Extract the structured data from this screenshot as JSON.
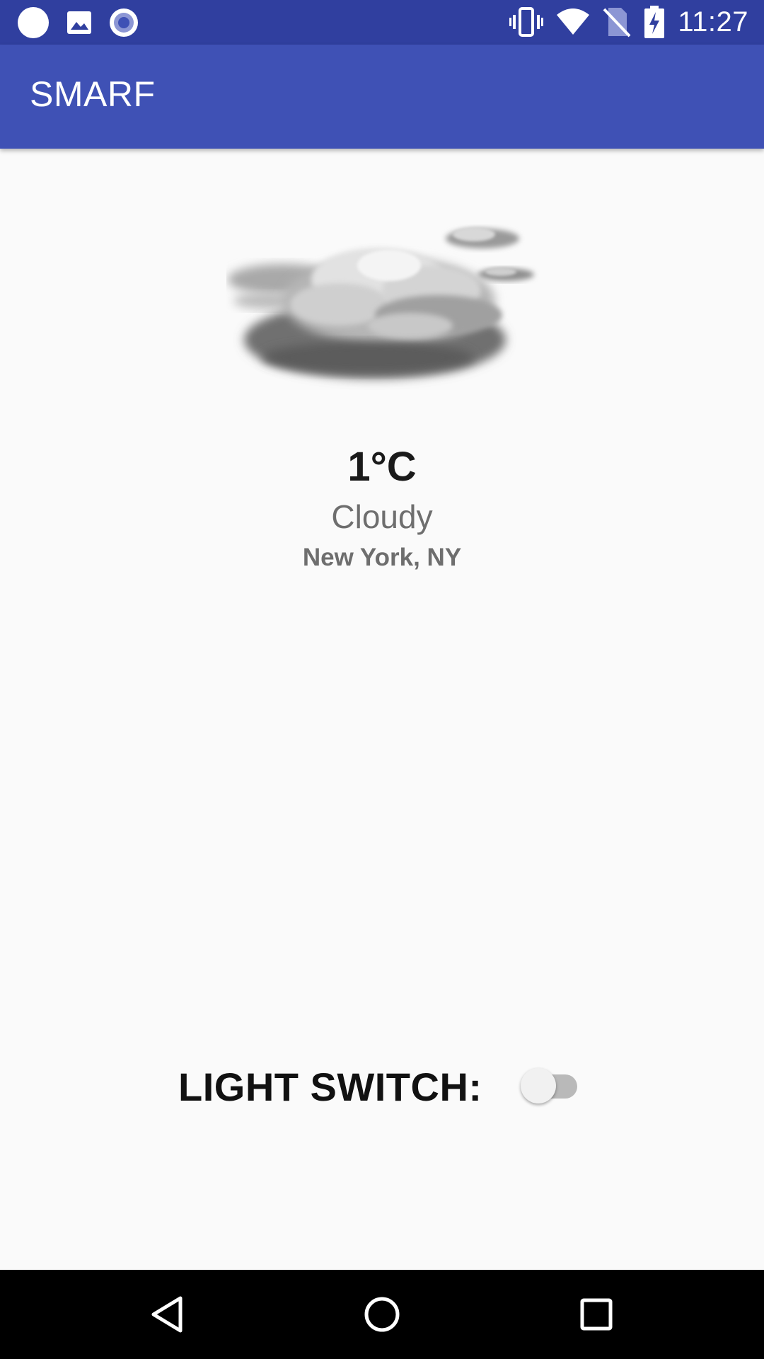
{
  "status_bar": {
    "time": "11:27",
    "left_icons": [
      "circle-notification-icon",
      "image-notification-icon",
      "radio-notification-icon"
    ],
    "right_icons": [
      "vibrate-icon",
      "wifi-icon",
      "no-sim-icon",
      "battery-charging-icon"
    ]
  },
  "app_bar": {
    "title": "SMARF",
    "color": "#3f51b5",
    "status_color": "#303f9f"
  },
  "weather": {
    "icon": "cloudy-icon",
    "temperature": "1°C",
    "condition": "Cloudy",
    "location": "New York, NY"
  },
  "light_switch": {
    "label": "LIGHT SWITCH:",
    "checked": false
  },
  "nav_bar": {
    "buttons": [
      "back-icon",
      "home-icon",
      "recents-icon"
    ]
  }
}
